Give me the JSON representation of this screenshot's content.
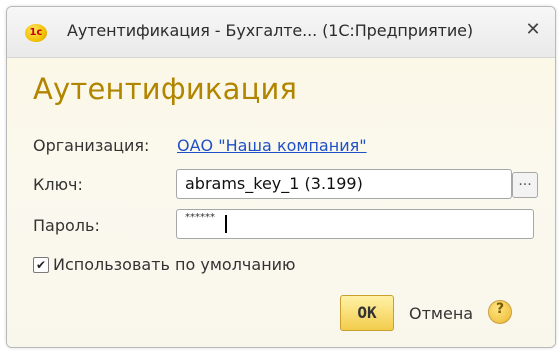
{
  "window": {
    "title": "Аутентификация - Бухгалте... (1С:Предприятие)",
    "icon_text": "1c",
    "close_symbol": "✕"
  },
  "heading": "Аутентификация",
  "organization": {
    "label": "Организация:",
    "value": "ОАО \"Наша компания\""
  },
  "key": {
    "label": "Ключ:",
    "value": "abrams_key_1 (3.199)",
    "browse_label": "..."
  },
  "password": {
    "label": "Пароль:",
    "masked_value": "******"
  },
  "default_checkbox": {
    "label": "Использовать по умолчанию",
    "checked": true,
    "check_symbol": "✔"
  },
  "buttons": {
    "ok": "OK",
    "cancel": "Отмена",
    "help": "?"
  }
}
